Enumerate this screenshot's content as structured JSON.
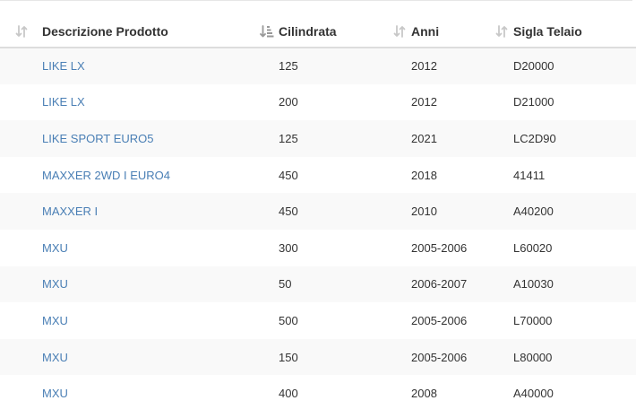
{
  "table": {
    "columns": [
      {
        "label": "Descrizione Prodotto",
        "sort_state": "unsorted",
        "icon": "sort-icon"
      },
      {
        "label": "Cilindrata",
        "sort_state": "ascending",
        "icon": "sort-amount-asc-icon"
      },
      {
        "label": "Anni",
        "sort_state": "unsorted",
        "icon": "sort-icon"
      },
      {
        "label": "Sigla Telaio",
        "sort_state": "unsorted",
        "icon": "sort-icon"
      }
    ],
    "rows": [
      {
        "descrizione": "LIKE LX",
        "cilindrata": "125",
        "anni": "2012",
        "sigla": "D20000"
      },
      {
        "descrizione": "LIKE LX",
        "cilindrata": "200",
        "anni": "2012",
        "sigla": "D21000"
      },
      {
        "descrizione": "LIKE SPORT EURO5",
        "cilindrata": "125",
        "anni": "2021",
        "sigla": "LC2D90"
      },
      {
        "descrizione": "MAXXER 2WD I EURO4",
        "cilindrata": "450",
        "anni": "2018",
        "sigla": "41411"
      },
      {
        "descrizione": "MAXXER I",
        "cilindrata": "450",
        "anni": "2010",
        "sigla": "A40200"
      },
      {
        "descrizione": "MXU",
        "cilindrata": "300",
        "anni": "2005-2006",
        "sigla": "L60020"
      },
      {
        "descrizione": "MXU",
        "cilindrata": "50",
        "anni": "2006-2007",
        "sigla": "A10030"
      },
      {
        "descrizione": "MXU",
        "cilindrata": "500",
        "anni": "2005-2006",
        "sigla": "L70000"
      },
      {
        "descrizione": "MXU",
        "cilindrata": "150",
        "anni": "2005-2006",
        "sigla": "L80000"
      },
      {
        "descrizione": "MXU",
        "cilindrata": "400",
        "anni": "2008",
        "sigla": "A40000"
      }
    ]
  },
  "colors": {
    "link": "#4a7fb5",
    "text": "#333333",
    "stripe": "#f9f9f9",
    "header_border": "#dddddd",
    "icon_muted": "#c8c8c8",
    "icon_active": "#999999"
  }
}
